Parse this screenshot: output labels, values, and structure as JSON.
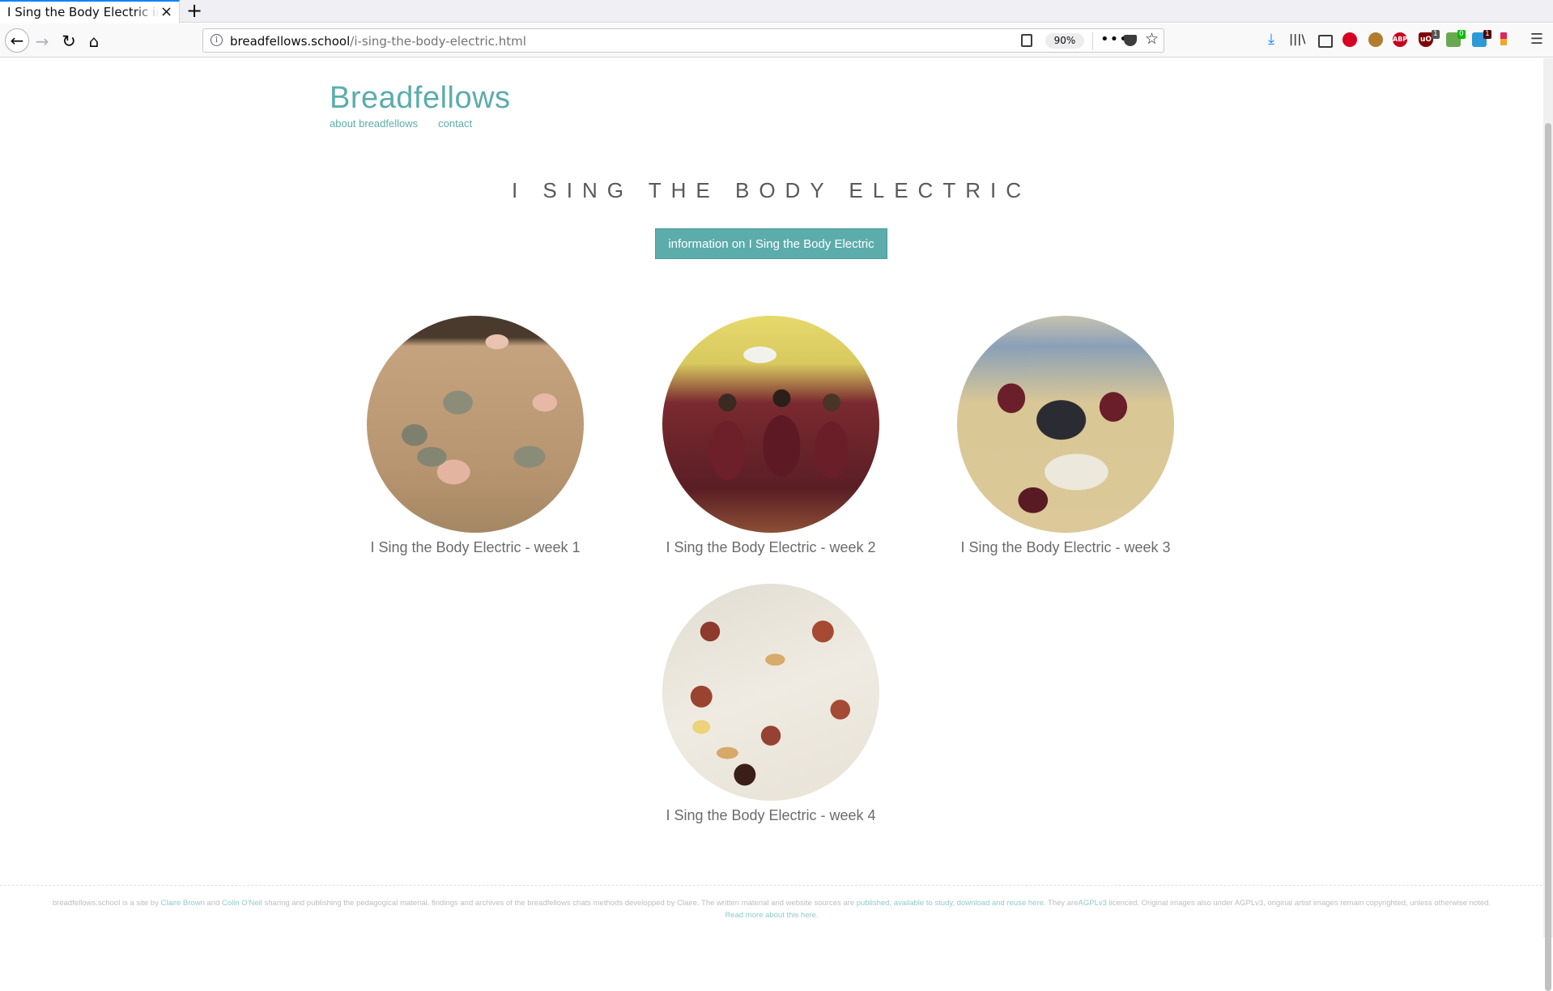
{
  "browser": {
    "tab_title": "I Sing the Body Electric index",
    "tab_close": "×",
    "new_tab": "+",
    "url_host": "breadfellows.school",
    "url_path": "/i-sing-the-body-electric.html",
    "zoom": "90%",
    "more": "•••",
    "bookmark_star": "☆",
    "badges": [
      "1",
      "0",
      "1"
    ],
    "ext_labels": [
      "ABP",
      "uO"
    ]
  },
  "site": {
    "title": "Breadfellows",
    "nav": [
      "about breadfellows",
      "contact"
    ]
  },
  "main": {
    "heading": "I SING THE BODY ELECTRIC",
    "info_button": "information on I Sing the Body Electric",
    "weeks": [
      {
        "caption": "I Sing the Body Electric - week 1"
      },
      {
        "caption": "I Sing the Body Electric - week 2"
      },
      {
        "caption": "I Sing the Body Electric - week 3"
      },
      {
        "caption": "I Sing the Body Electric - week 4"
      }
    ]
  },
  "footer": {
    "t1": "breadfellows.school is a site by ",
    "claire": "Claire Brown",
    "and": " and ",
    "colin": "Colin O'Neil",
    "t2": " sharing and publishing the pedagogical material, findings and archives of the breadfellows chats methods developped by Claire. The written material and website sources are ",
    "published": "published, available to study, download and reuse here.",
    "t3": " They are",
    "agpl": "AGPLv3",
    "t4": " licenced. Original images also under AGPLv3, original artist images remain copyrighted, unless otherwise noted. ",
    "readmore": "Read more about this here."
  },
  "colors": {
    "accent": "#5cacac",
    "text": "#6b6b6b"
  }
}
